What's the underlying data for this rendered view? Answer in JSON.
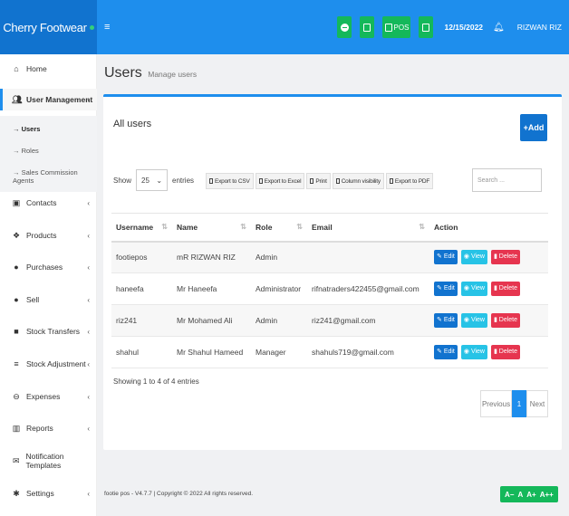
{
  "brand": "Cherry Footwear",
  "header": {
    "menu_icon": "≡",
    "pos_label": "POS",
    "date": "12/15/2022",
    "user": "RIZWAN RIZ"
  },
  "sidebar": {
    "items": [
      {
        "label": "Home",
        "icon": "home-icon"
      },
      {
        "label": "User Management",
        "icon": "users-icon"
      },
      {
        "label": "Contacts",
        "icon": "contact-icon"
      },
      {
        "label": "Products",
        "icon": "cubes-icon"
      },
      {
        "label": "Purchases",
        "icon": "arrow-circle-down-icon"
      },
      {
        "label": "Sell",
        "icon": "arrow-circle-up-icon"
      },
      {
        "label": "Stock Transfers",
        "icon": "truck-icon"
      },
      {
        "label": "Stock Adjustment",
        "icon": "database-icon"
      },
      {
        "label": "Expenses",
        "icon": "minus-circle-icon"
      },
      {
        "label": "Reports",
        "icon": "chart-icon"
      },
      {
        "label": "Notification Templates",
        "icon": "envelope-icon"
      },
      {
        "label": "Settings",
        "icon": "cog-icon"
      }
    ],
    "sub": [
      "Users",
      "Roles",
      "Sales Commission Agents"
    ]
  },
  "page": {
    "title": "Users",
    "subtitle": "Manage users",
    "box_title": "All users",
    "add_label": "+Add",
    "show_label": "Show",
    "entries_value": "25",
    "entries_label": "entries",
    "tools": [
      "Export to CSV",
      "Export to Excel",
      "Print",
      "Column visibility",
      "Export to PDF"
    ],
    "search_placeholder": "Search ...",
    "columns": [
      "Username",
      "Name",
      "Role",
      "Email",
      "Action"
    ],
    "rows": [
      {
        "username": "footiepos",
        "name": "mR RIZWAN RIZ",
        "role": "Admin",
        "email": ""
      },
      {
        "username": "haneefa",
        "name": "Mr Haneefa",
        "role": "Administrator",
        "email": "rifnatraders422455@gmail.com"
      },
      {
        "username": "riz241",
        "name": "Mr Mohamed Ali",
        "role": "Admin",
        "email": "riz241@gmail.com"
      },
      {
        "username": "shahul",
        "name": "Mr Shahul Hameed",
        "role": "Manager",
        "email": "shahuls719@gmail.com"
      }
    ],
    "actions": {
      "edit": "Edit",
      "view": "View",
      "delete": "Delete"
    },
    "showing": "Showing 1 to 4 of 4 entries",
    "pager": {
      "prev": "Previous",
      "page": "1",
      "next": "Next"
    },
    "footer": "footie pos - V4.7.7 | Copyright © 2022 All rights reserved.",
    "font_buttons": [
      "A−",
      "A",
      "A+",
      "A++"
    ]
  },
  "colors": {
    "brand": "#1173cf",
    "navbar": "#1e8eed",
    "green": "#14b85a",
    "danger": "#e6354f",
    "info": "#27c3e6"
  }
}
